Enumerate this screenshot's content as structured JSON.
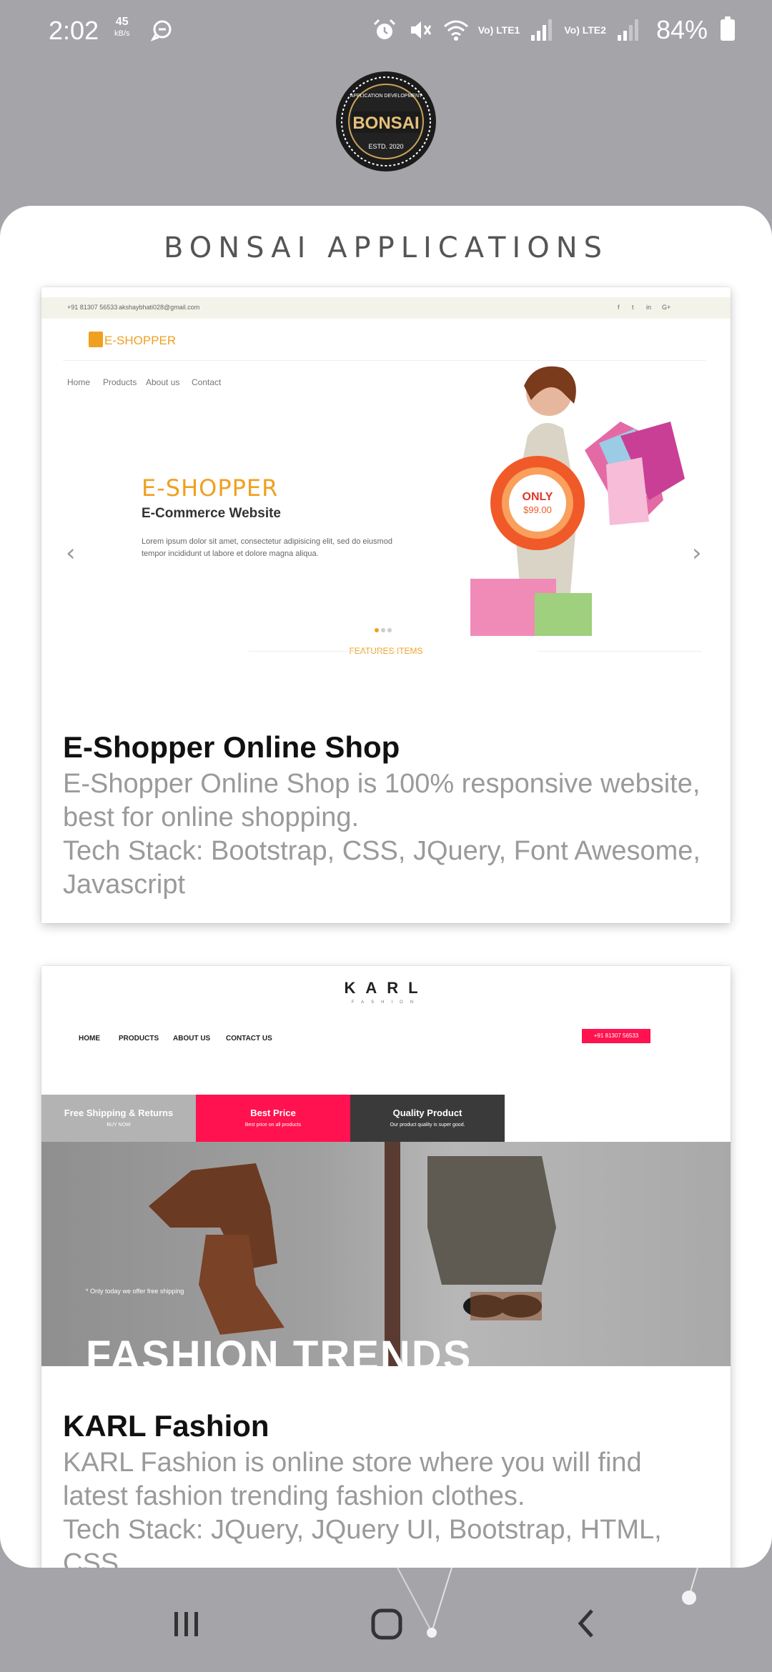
{
  "status_bar": {
    "time": "2:02",
    "speed_value": "45",
    "speed_unit": "kB/s",
    "sim1": "Vo) LTE1",
    "sim2": "Vo) LTE2",
    "battery": "84%"
  },
  "logo": {
    "arc_text": "APPLICATION DEVELOPMENT",
    "name": "BONSAI",
    "estd": "ESTD. 2020"
  },
  "header": {
    "title": "BONSAI APPLICATIONS"
  },
  "apps": [
    {
      "name": "E-Shopper Online Shop",
      "description": "E-Shopper Online Shop is 100% responsive website, best for online shopping.",
      "tech_stack": "Tech Stack: Bootstrap, CSS, JQuery, Font Awesome, Javascript",
      "preview": {
        "phone": "+91 81307 56533",
        "email": "akshaybhati028@gmail.com",
        "social": [
          "f",
          "t",
          "in",
          "G+"
        ],
        "logo": "E-SHOPPER",
        "nav": [
          "Home",
          "Products",
          "About us",
          "Contact"
        ],
        "hero_title": "E-SHOPPER",
        "hero_subtitle": "E-Commerce Website",
        "hero_text": "Lorem ipsum dolor sit amet, consectetur adipisicing elit, sed do eiusmod tempor incididunt ut labore et dolore magna aliqua.",
        "badge_top": "ONLY",
        "badge_price": "$99.00",
        "features": "FEATURES ITEMS"
      }
    },
    {
      "name": "KARL Fashion",
      "description": "KARL Fashion is online store where you will find latest fashion trending fashion clothes.",
      "tech_stack": "Tech Stack: JQuery, JQuery UI, Bootstrap, HTML, CSS",
      "preview": {
        "logo": "KARL",
        "logo_sub": "FASHION",
        "nav": [
          "HOME",
          "PRODUCTS",
          "ABOUT US",
          "CONTACT US"
        ],
        "phone": "+91 81307 56533",
        "strips": [
          {
            "title": "Free Shipping & Returns",
            "sub": "BUY NOW"
          },
          {
            "title": "Best Price",
            "sub": "Best price on all products"
          },
          {
            "title": "Quality Product",
            "sub": "Our product quality is super good."
          }
        ],
        "offer": "* Only today we offer free shipping",
        "headline": "FASHION TRENDS"
      }
    }
  ],
  "colors": {
    "background": "#a5a4a9",
    "panel": "#ffffff",
    "title": "#555555",
    "desc": "#9a9a9a",
    "eshopper_accent": "#f0a020",
    "karl_accent": "#ff124f"
  },
  "nav_bar": {
    "icons": [
      "recent-apps-icon",
      "home-icon",
      "back-icon"
    ]
  }
}
